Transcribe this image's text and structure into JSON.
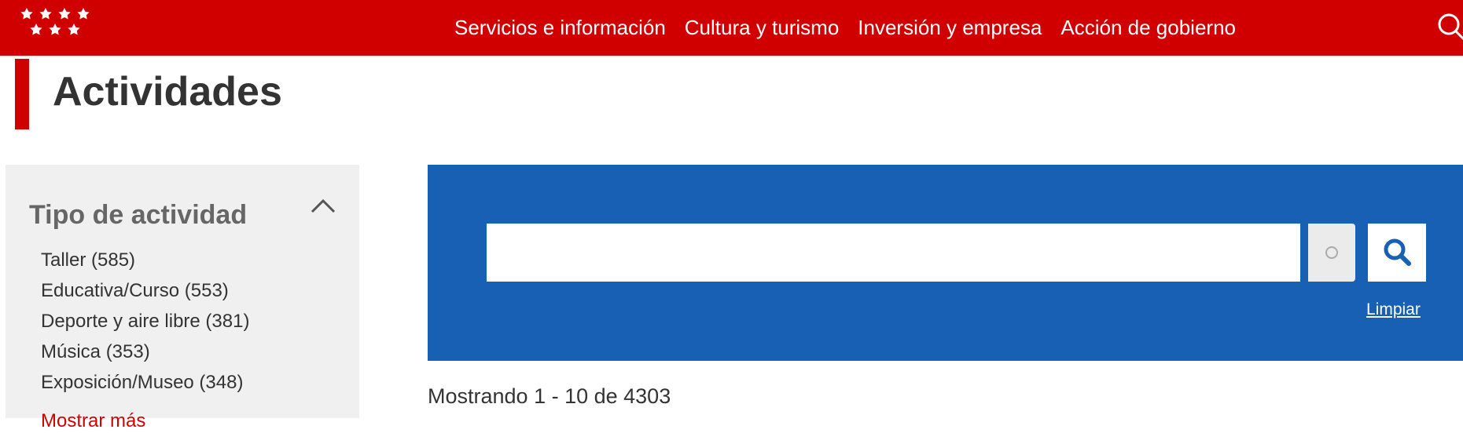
{
  "header": {
    "nav": [
      {
        "label": "Servicios e información"
      },
      {
        "label": "Cultura y turismo"
      },
      {
        "label": "Inversión y empresa"
      },
      {
        "label": "Acción de gobierno"
      }
    ],
    "logo_icon": "stars-logo-icon",
    "search_icon": "search-icon",
    "brand_color": "#d10000"
  },
  "page": {
    "title": "Actividades"
  },
  "sidebar": {
    "facet_title": "Tipo de actividad",
    "toggle_icon": "chevron-up-icon",
    "items": [
      {
        "label": "Taller (585)"
      },
      {
        "label": "Educativa/Curso (553)"
      },
      {
        "label": "Deporte y aire libre (381)"
      },
      {
        "label": "Música (353)"
      },
      {
        "label": "Exposición/Museo (348)"
      }
    ],
    "show_more": "Mostrar más"
  },
  "search": {
    "value": "",
    "placeholder": "",
    "button_icon": "search-icon",
    "clear_label": "Limpiar",
    "panel_color": "#1760b3"
  },
  "results": {
    "summary": "Mostrando 1 - 10 de 4303"
  }
}
